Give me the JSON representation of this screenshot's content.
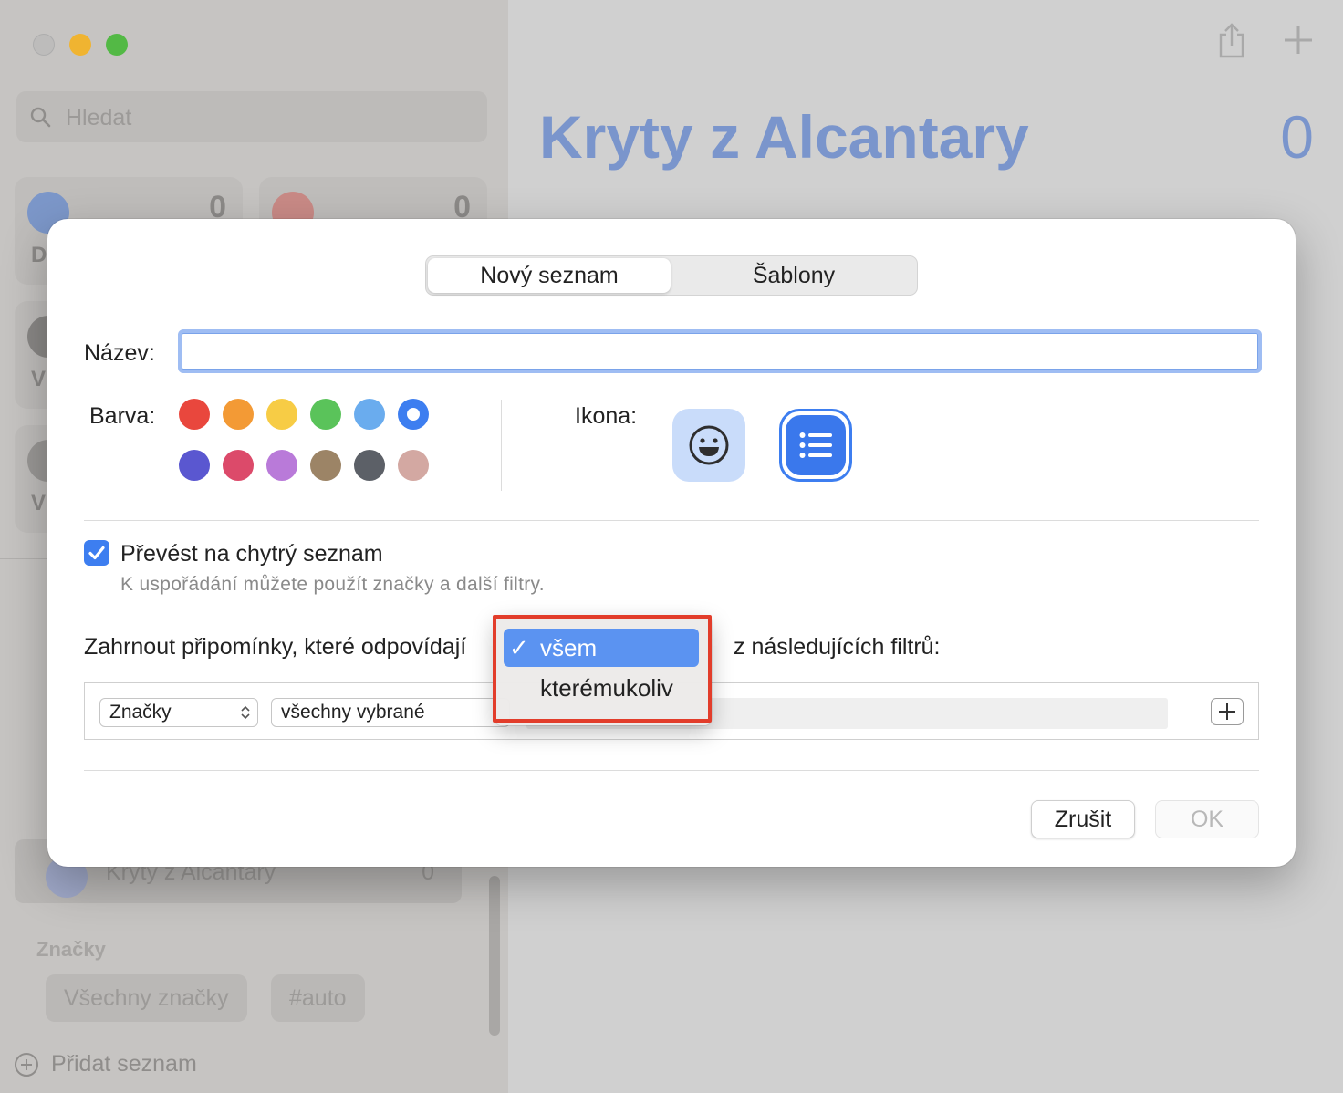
{
  "sidebar": {
    "search_placeholder": "Hledat",
    "cards": [
      {
        "letter": "D",
        "count": "0"
      },
      {
        "letter": "",
        "count": "0"
      },
      {
        "letter": "V"
      },
      {
        "letter": "V"
      }
    ],
    "selected_list": {
      "name": "Kryty z Alcantary",
      "count": "0"
    },
    "tags_header": "Značky",
    "tags": [
      "Všechny značky",
      "#auto"
    ],
    "add_list": "Přidat seznam"
  },
  "main": {
    "title": "Kryty z Alcantary",
    "count": "0"
  },
  "dialog": {
    "tabs": {
      "new_list": "Nový seznam",
      "templates": "Šablony"
    },
    "name_label": "Název:",
    "name_value": "",
    "color_label": "Barva:",
    "icon_label": "Ikona:",
    "colors": [
      "#e9473d",
      "#f39a35",
      "#f7cc45",
      "#5ac35a",
      "#6aacee",
      "#3d7ef0",
      "#5a57d0",
      "#dc4a6a",
      "#b97ad9",
      "#9c8466",
      "#5c6067",
      "#d3a8a2"
    ],
    "selected_color_index": 5,
    "smart_list_checkbox": "Převést na chytrý seznam",
    "smart_list_checked": true,
    "smart_list_hint": "K uspořádání můžete použít značky a další filtry.",
    "include_prefix": "Zahrnout připomínky, které odpovídají",
    "include_suffix": "z následujících filtrů:",
    "filter": {
      "field": "Značky",
      "condition": "všechny vybrané"
    },
    "dropdown": {
      "items": [
        "všem",
        "kterémukoliv"
      ],
      "selected_index": 0,
      "check": "✓"
    },
    "buttons": {
      "cancel": "Zrušit",
      "ok": "OK"
    }
  }
}
